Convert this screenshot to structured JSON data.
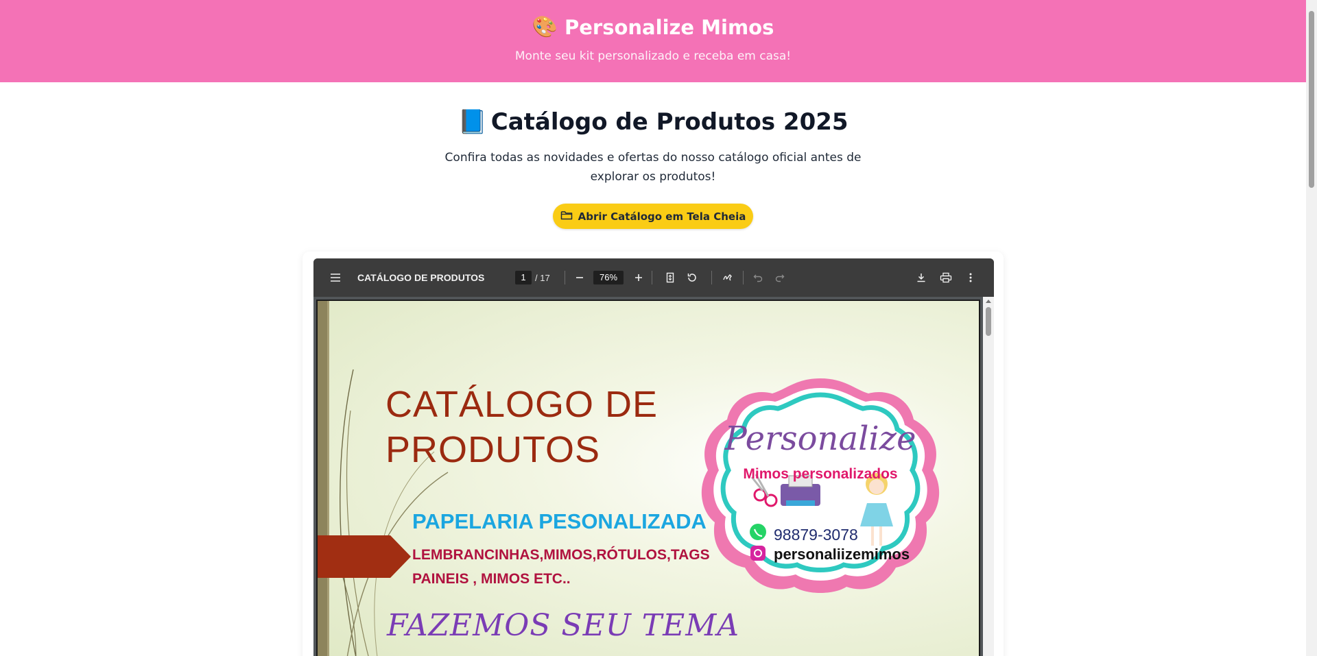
{
  "header": {
    "brand_emoji": "🎨",
    "brand": "Personalize Mimos",
    "tagline": "Monte seu kit personalizado e receba em casa!"
  },
  "catalog": {
    "title_emoji": "📘",
    "title": "Catálogo de Produtos 2025",
    "description": "Confira todas as novidades e ofertas do nosso catálogo oficial antes de explorar os produtos!",
    "open_button": "Abrir Catálogo em Tela Cheia"
  },
  "pdf_viewer": {
    "title": "CATÁLOGO DE PRODUTOS",
    "page_current": "1",
    "page_total": "/ 17",
    "zoom": "76%",
    "icons": [
      "menu-icon",
      "zoom-out-icon",
      "zoom-in-icon",
      "fit-page-icon",
      "rotate-icon",
      "annotate-icon",
      "undo-icon",
      "redo-icon",
      "download-icon",
      "print-icon",
      "more-options-icon"
    ]
  },
  "pdf_page": {
    "title_line1": "CATÁLOGO DE",
    "title_line2": "PRODUTOS",
    "papelaria": "PAPELARIA PESONALIZADA",
    "lembrancinhas_line1": "LEMBRANCINHAS,MIMOS,RÓTULOS,TAGS",
    "lembrancinhas_line2": "PAINEIS , MIMOS ETC..",
    "fazemos": "FAZEMOS SEU TEMA",
    "logo": {
      "name": "Personalize",
      "subtitle": "Mimos personalizados",
      "phone": "98879-3078",
      "instagram": "personaliizemimos"
    }
  },
  "colors": {
    "header_bg": "#f472b6",
    "button_bg": "#facc15",
    "toolbar_bg": "#3c3c3c"
  }
}
